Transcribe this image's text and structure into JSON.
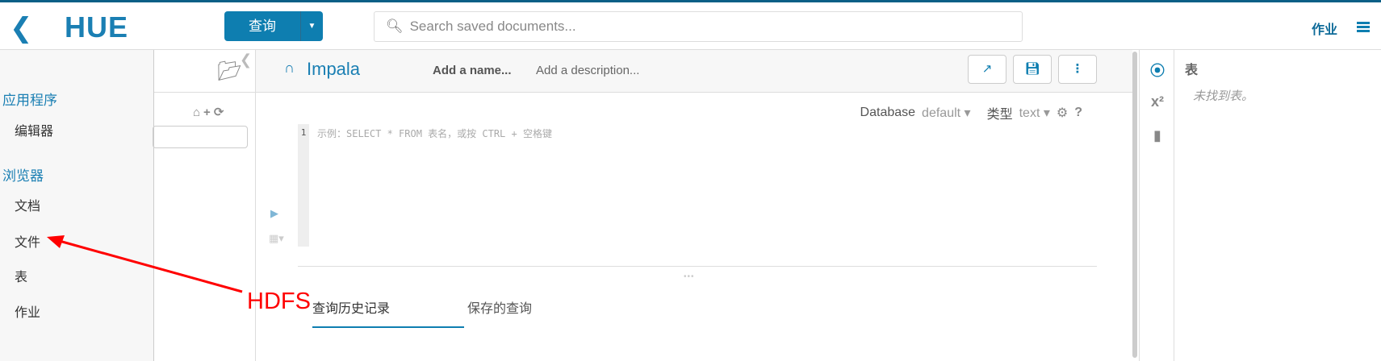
{
  "header": {
    "logo": "HUE",
    "query_button": "查询",
    "search_placeholder": "Search saved documents...",
    "jobs": "作业"
  },
  "sidebar": {
    "sections": [
      {
        "title": "应用程序",
        "items": [
          "编辑器"
        ]
      },
      {
        "title": "浏览器",
        "items": [
          "文档",
          "文件",
          "表",
          "作业"
        ]
      }
    ]
  },
  "editor": {
    "engine": "Impala",
    "name_placeholder": "Add a name...",
    "description_placeholder": "Add a description...",
    "database_label": "Database",
    "database_value": "default",
    "type_label": "类型",
    "type_value": "text",
    "line_number": "1",
    "code_placeholder": "示例：SELECT * FROM 表名，或按 CTRL + 空格键",
    "tabs": [
      "查询历史记录",
      "保存的查询"
    ]
  },
  "right_panel": {
    "title": "表",
    "empty": "未找到表。",
    "x2": "x²"
  },
  "annotation": {
    "label": "HDFS",
    "color": "#ff0000"
  }
}
